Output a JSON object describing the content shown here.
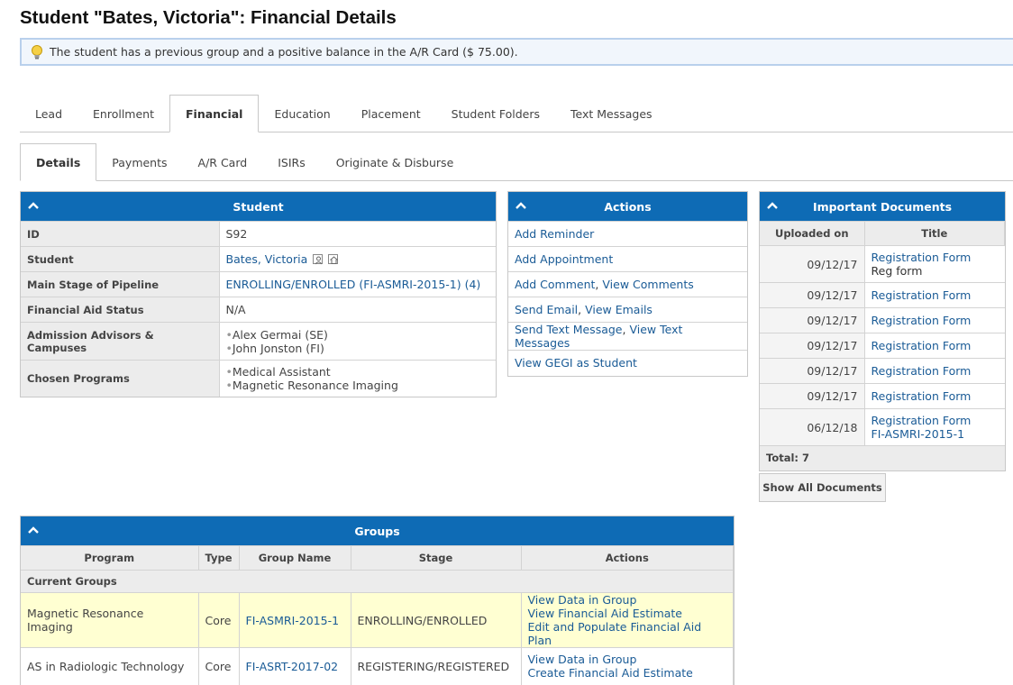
{
  "page": {
    "title": "Student \"Bates, Victoria\": Financial Details"
  },
  "alert": {
    "text": "The student has a previous group and a positive balance in the A/R Card ($ 75.00)."
  },
  "main_tabs": [
    "Lead",
    "Enrollment",
    "Financial",
    "Education",
    "Placement",
    "Student Folders",
    "Text Messages"
  ],
  "sub_tabs": [
    "Details",
    "Payments",
    "A/R Card",
    "ISIRs",
    "Originate & Disburse"
  ],
  "student": {
    "title": "Student",
    "rows": {
      "id": {
        "label": "ID",
        "value": "S92"
      },
      "student": {
        "label": "Student",
        "value": "Bates, Victoria"
      },
      "stage": {
        "label": "Main Stage of Pipeline",
        "value": "ENROLLING/ENROLLED (FI-ASMRI-2015-1) (4)"
      },
      "aid_status": {
        "label": "Financial Aid Status",
        "value": "N/A"
      },
      "advisors": {
        "label": "Admission Advisors & Campuses",
        "items": [
          "Alex Germai (SE)",
          "John Jonston (FI)"
        ]
      },
      "programs": {
        "label": "Chosen Programs",
        "items": [
          "Medical Assistant",
          "Magnetic Resonance Imaging"
        ]
      }
    }
  },
  "actions": {
    "title": "Actions",
    "add_reminder": "Add Reminder",
    "add_appointment": "Add Appointment",
    "add_comment": "Add Comment",
    "view_comments": "View Comments",
    "send_email": "Send Email",
    "view_emails": "View Emails",
    "send_text": "Send Text Message",
    "view_texts": "View Text Messages",
    "view_gegi": "View GEGI as Student",
    "separator": ", "
  },
  "documents": {
    "title": "Important Documents",
    "col_uploaded": "Uploaded on",
    "col_title": "Title",
    "rows": [
      {
        "date": "09/12/17",
        "title": "Registration Form",
        "sub": "Reg form"
      },
      {
        "date": "09/12/17",
        "title": "Registration Form"
      },
      {
        "date": "09/12/17",
        "title": "Registration Form"
      },
      {
        "date": "09/12/17",
        "title": "Registration Form"
      },
      {
        "date": "09/12/17",
        "title": "Registration Form"
      },
      {
        "date": "09/12/17",
        "title": "Registration Form"
      },
      {
        "date": "06/12/18",
        "title": "Registration Form",
        "title2": "FI-ASMRI-2015-1"
      }
    ],
    "total": "Total: 7",
    "show_all": "Show All Documents"
  },
  "groups": {
    "title": "Groups",
    "columns": [
      "Program",
      "Type",
      "Group Name",
      "Stage",
      "Actions"
    ],
    "section_current": "Current Groups",
    "rows": [
      {
        "program": "Magnetic Resonance Imaging",
        "type": "Core",
        "group": "FI-ASMRI-2015-1",
        "stage": "ENROLLING/ENROLLED",
        "actions": [
          "View Data in Group",
          "View Financial Aid Estimate",
          "Edit and Populate Financial Aid Plan"
        ]
      },
      {
        "program": "AS in Radiologic Technology",
        "type": "Core",
        "group": "FI-ASRT-2017-02",
        "stage": "REGISTERING/REGISTERED",
        "actions": [
          "View Data in Group",
          "Create Financial Aid Estimate"
        ]
      }
    ]
  },
  "colors": {
    "panel_header": "#0e6bb5",
    "link": "#1a5b96",
    "highlight_row": "#ffffd2"
  }
}
